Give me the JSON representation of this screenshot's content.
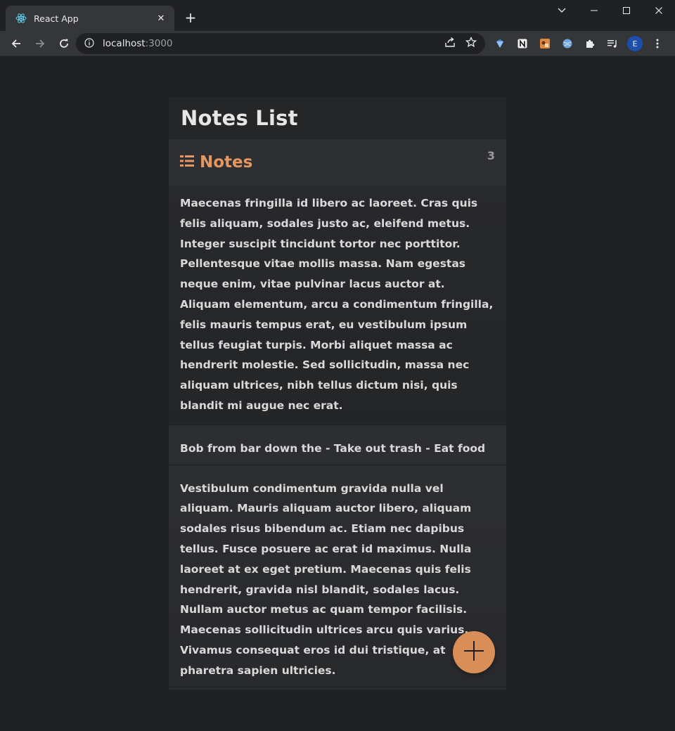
{
  "browser": {
    "tab_title": "React App",
    "tab_close": "✕",
    "new_tab": "+",
    "url_host": "localhost",
    "url_port": ":3000",
    "avatar_letter": "E",
    "icons": [
      "react-logo-icon",
      "back-arrow-icon",
      "forward-arrow-icon",
      "reload-icon",
      "info-icon",
      "share-icon",
      "star-icon",
      "extension-gem-icon",
      "notion-icon",
      "extension-orange-icon",
      "extension-globe-icon",
      "puzzle-icon",
      "media-icon"
    ]
  },
  "app": {
    "title": "Notes List",
    "notes_label": "Notes",
    "notes_count": "3",
    "accent_color": "#e6965f",
    "fab_color": "#d98e58",
    "notes": [
      {
        "text": "Maecenas fringilla id libero ac laoreet. Cras quis felis aliquam, sodales justo ac, eleifend metus. Integer suscipit tincidunt tortor nec porttitor. Pellentesque vitae mollis massa. Nam egestas neque enim, vitae pulvinar lacus auctor at. Aliquam elementum, arcu a condimentum fringilla, felis mauris tempus erat, eu vestibulum ipsum tellus feugiat turpis. Morbi aliquet massa ac hendrerit molestie. Sed sollicitudin, massa nec aliquam ultrices, nibh tellus dictum nisi, quis blandit mi augue nec erat."
      },
      {
        "text": "Bob from bar down the - Take out trash - Eat food"
      },
      {
        "text": "Vestibulum condimentum gravida nulla vel aliquam. Mauris aliquam auctor libero, aliquam sodales risus bibendum ac. Etiam nec dapibus tellus. Fusce posuere ac erat id maximus. Nulla laoreet at ex eget pretium. Maecenas quis felis hendrerit, gravida nisl blandit, sodales lacus. Nullam auctor metus ac quam tempor facilisis. Maecenas sollicitudin ultrices arcu quis varius. Vivamus consequat eros id dui tristique, at pharetra sapien ultricies."
      }
    ]
  }
}
